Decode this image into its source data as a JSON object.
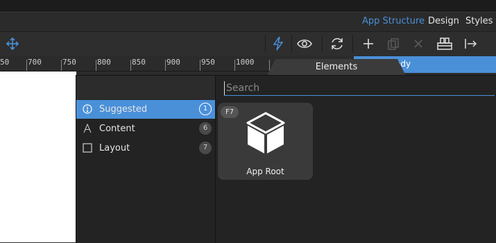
{
  "tabs": {
    "app_structure": "App Structure",
    "design": "Design",
    "styles": "Styles"
  },
  "toolbar": {
    "move": "move-icon",
    "lightning": "lightning-icon",
    "eye": "eye-icon",
    "refresh": "refresh-icon",
    "add": "plus-icon",
    "copy": "copy-icon",
    "delete": "close-icon",
    "component": "component-icon",
    "export": "export-icon"
  },
  "ruler": {
    "labels": [
      "50",
      "700",
      "750",
      "800",
      "850",
      "900",
      "950",
      "1000"
    ]
  },
  "body_bar": {
    "label": "ody"
  },
  "panel": {
    "tab_label": "Elements",
    "search_placeholder": "Search",
    "categories": [
      {
        "label": "Suggested",
        "count": "1",
        "icon": "info-icon"
      },
      {
        "label": "Content",
        "count": "6",
        "icon": "text-icon"
      },
      {
        "label": "Layout",
        "count": "7",
        "icon": "square-icon"
      }
    ],
    "element_card": {
      "shortcut": "F7",
      "name": "App Root",
      "icon": "cube-icon"
    }
  },
  "colors": {
    "accent": "#4a90d9",
    "panel_bg": "#232323",
    "card_bg": "#3a3a3a"
  }
}
